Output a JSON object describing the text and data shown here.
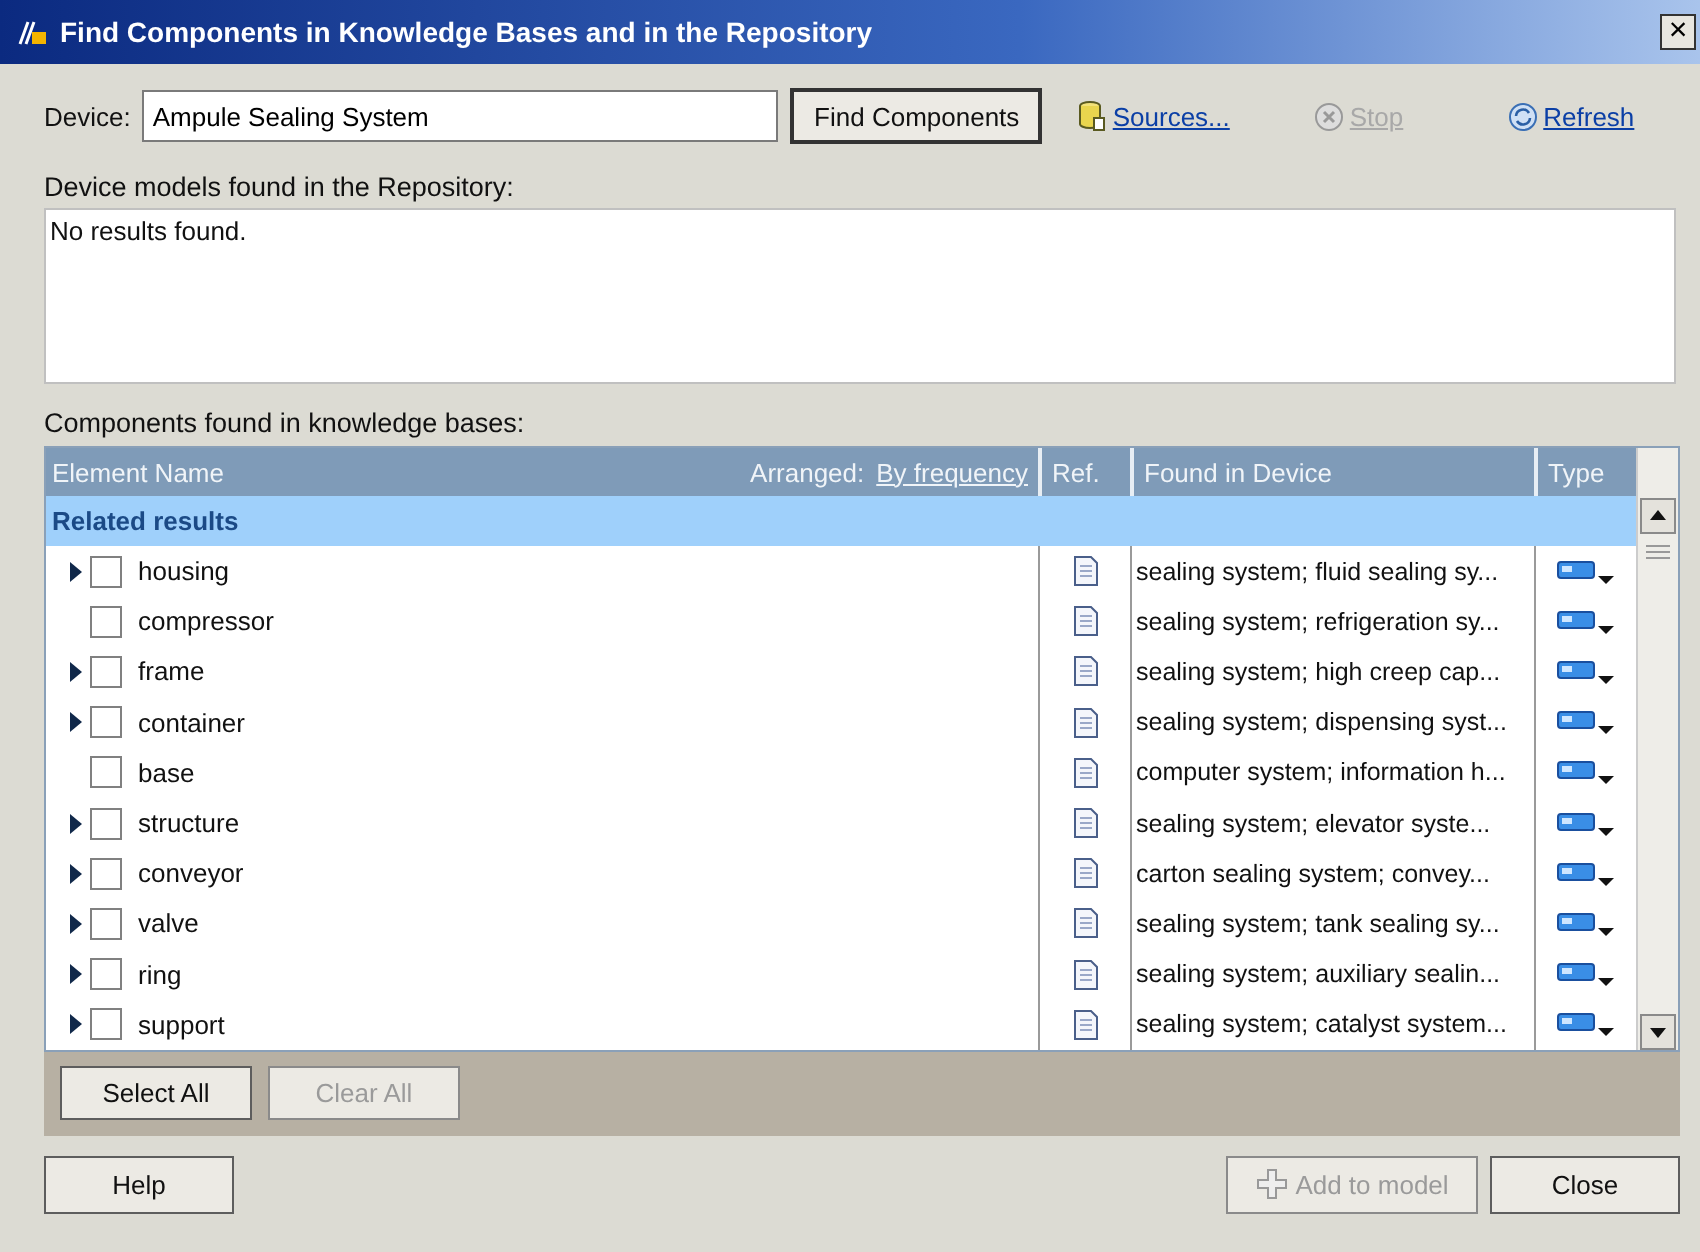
{
  "window": {
    "title": "Find Components in Knowledge Bases and in the Repository",
    "close": "×"
  },
  "device": {
    "label": "Device:",
    "value": "Ampule Sealing System"
  },
  "search_button": {
    "label": "Find Components"
  },
  "links": [
    {
      "label": "Sources...",
      "kind": "sources",
      "disabled": false
    },
    {
      "label": "Stop",
      "kind": "stop",
      "disabled": true
    },
    {
      "label": "Refresh",
      "kind": "refresh",
      "disabled": false
    }
  ],
  "repository": {
    "label": "Device models found in the Repository:",
    "message": "No results found."
  },
  "components": {
    "label": "Components found in knowledge bases:",
    "columns": {
      "name": "Element Name",
      "arranged": "Arranged:",
      "sort": "By frequency",
      "ref": "Ref.",
      "found": "Found in Device",
      "type": "Type"
    },
    "group": "Related results",
    "rows": [
      {
        "name": "housing",
        "expandable": true,
        "checked": false,
        "found": "sealing system; fluid sealing sy..."
      },
      {
        "name": "compressor",
        "expandable": false,
        "checked": false,
        "found": "sealing system; refrigeration sy..."
      },
      {
        "name": "frame",
        "expandable": true,
        "checked": false,
        "found": "sealing system; high creep cap..."
      },
      {
        "name": "container",
        "expandable": true,
        "checked": false,
        "found": "sealing system; dispensing syst..."
      },
      {
        "name": "base",
        "expandable": false,
        "checked": false,
        "found": "computer system; information h..."
      },
      {
        "name": "structure",
        "expandable": true,
        "checked": false,
        "found": "sealing system; elevator syste..."
      },
      {
        "name": "conveyor",
        "expandable": true,
        "checked": false,
        "found": "carton sealing system; convey..."
      },
      {
        "name": "valve",
        "expandable": true,
        "checked": false,
        "found": "sealing system; tank sealing sy..."
      },
      {
        "name": "ring",
        "expandable": true,
        "checked": false,
        "found": "sealing system; auxiliary sealin..."
      },
      {
        "name": "support",
        "expandable": true,
        "checked": false,
        "found": "sealing system; catalyst system..."
      }
    ]
  },
  "selection_buttons": [
    {
      "label": "Select All",
      "disabled": false
    },
    {
      "label": "Clear All",
      "disabled": true
    }
  ],
  "footer": {
    "help": "Help",
    "add": {
      "label": "Add to model",
      "disabled": true
    },
    "close": "Close"
  }
}
